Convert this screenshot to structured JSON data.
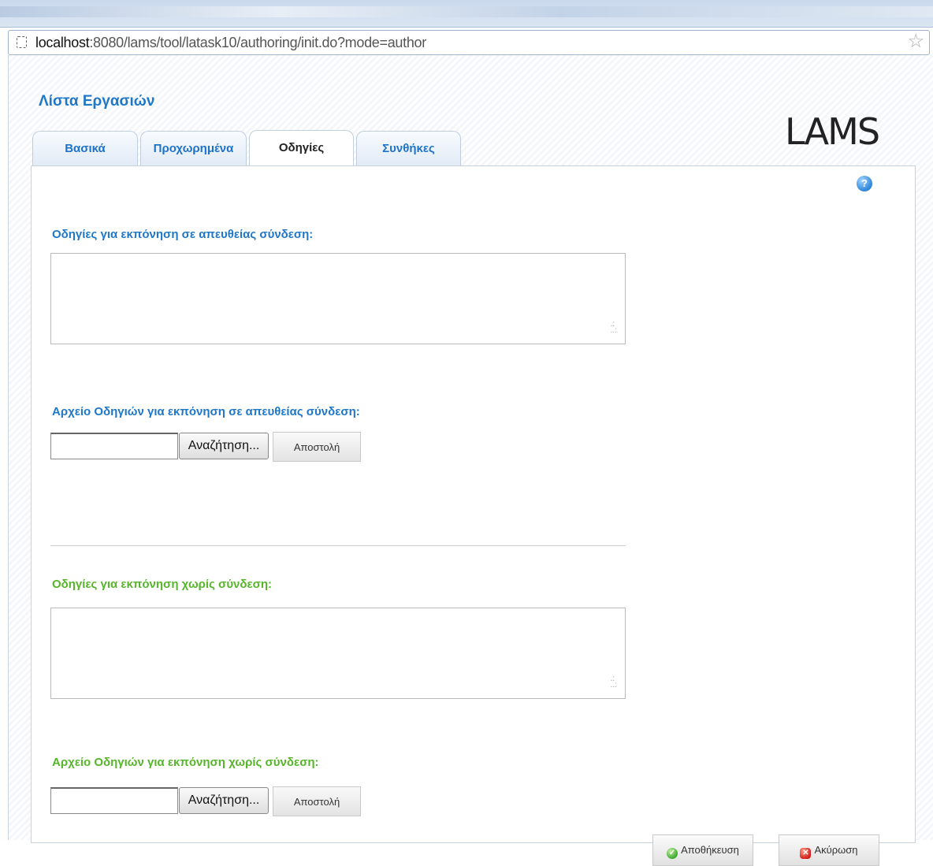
{
  "browser": {
    "url_host": "localhost",
    "url_rest": ":8080/lams/tool/latask10/authoring/init.do?mode=author"
  },
  "page": {
    "title": "Λίστα Εργασιών",
    "logo": "LAMS"
  },
  "tabs": [
    {
      "label": "Βασικά",
      "active": false
    },
    {
      "label": "Προχωρημένα",
      "active": false
    },
    {
      "label": "Οδηγίες",
      "active": true
    },
    {
      "label": "Συνθήκες",
      "active": false
    }
  ],
  "help": {
    "icon": "help-icon",
    "glyph": "?"
  },
  "online": {
    "instructions_label": "Οδηγίες για εκπόνηση σε απευθείας σύνδεση:",
    "instructions_value": "",
    "file_label": "Αρχείο Οδηγιών για εκπόνηση σε απευθείας σύνδεση:",
    "file_value": "",
    "browse_label": "Αναζήτηση...",
    "upload_label": "Αποστολή"
  },
  "offline": {
    "instructions_label": "Οδηγίες για εκπόνηση χωρίς σύνδεση:",
    "instructions_value": "",
    "file_label": "Αρχείο Οδηγιών για εκπόνηση χωρίς σύνδεση:",
    "file_value": "",
    "browse_label": "Αναζήτηση...",
    "upload_label": "Αποστολή"
  },
  "actions": {
    "save_label": "Αποθήκευση",
    "cancel_label": "Ακύρωση"
  },
  "colors": {
    "blue_heading": "#1f77c8",
    "green_heading": "#56b52a"
  }
}
